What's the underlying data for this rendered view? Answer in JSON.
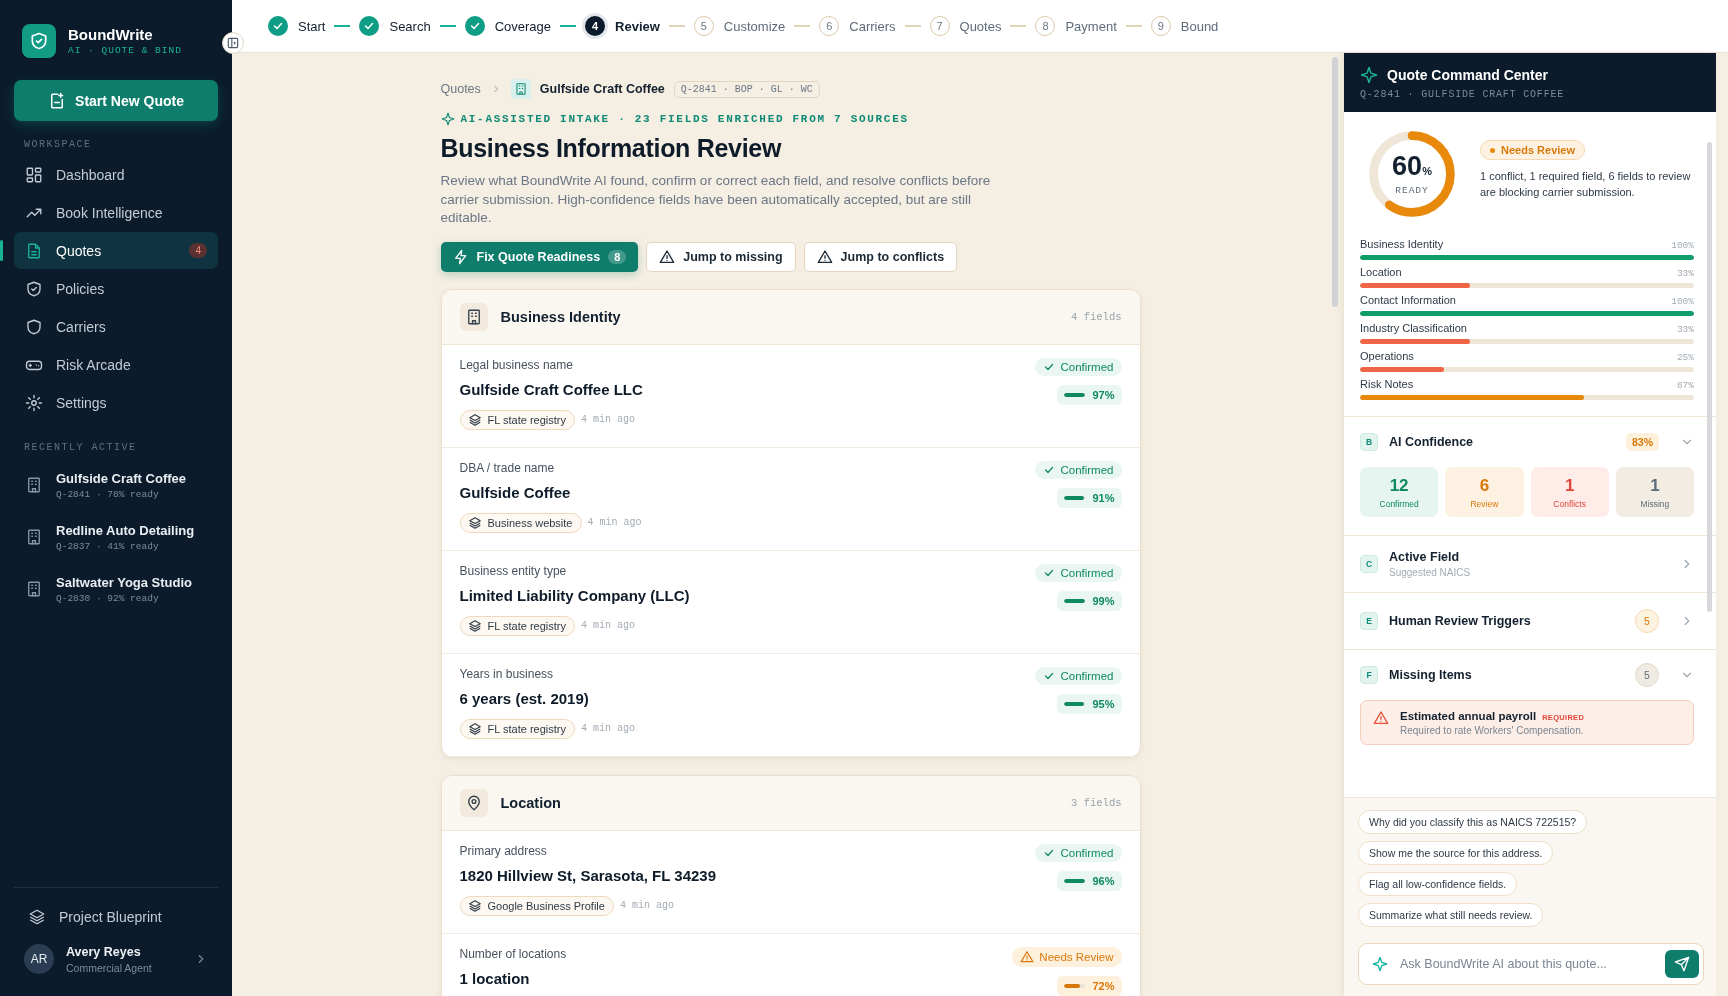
{
  "brand": {
    "name": "BoundWrite",
    "tagline": "AI · QUOTE & BIND"
  },
  "sidebar": {
    "new_quote_button": "Start New Quote",
    "workspace_label": "WORKSPACE",
    "nav": [
      {
        "label": "Dashboard",
        "kind": "grid",
        "selected": false
      },
      {
        "label": "Book Intelligence",
        "kind": "trend",
        "selected": false
      },
      {
        "label": "Quotes",
        "kind": "doc",
        "selected": true,
        "badge": "4"
      },
      {
        "label": "Policies",
        "kind": "policy",
        "selected": false
      },
      {
        "label": "Carriers",
        "kind": "shield",
        "selected": false
      },
      {
        "label": "Risk Arcade",
        "kind": "gamepad",
        "selected": false
      },
      {
        "label": "Settings",
        "kind": "gear",
        "selected": false
      }
    ],
    "recent_label": "RECENTLY ACTIVE",
    "recent": [
      {
        "name": "Gulfside Craft Coffee",
        "meta": "Q-2841 · 78% ready"
      },
      {
        "name": "Redline Auto Detailing",
        "meta": "Q-2837 · 41% ready"
      },
      {
        "name": "Saltwater Yoga Studio",
        "meta": "Q-2830 · 92% ready"
      }
    ],
    "blueprint": "Project Blueprint",
    "user": {
      "initials": "AR",
      "name": "Avery Reyes",
      "role": "Commercial Agent"
    }
  },
  "steps": [
    {
      "label": "Start",
      "kind": "done"
    },
    {
      "label": "Search",
      "kind": "done"
    },
    {
      "label": "Coverage",
      "kind": "done"
    },
    {
      "number": "4",
      "label": "Review",
      "kind": "current"
    },
    {
      "number": "5",
      "label": "Customize",
      "kind": "todo"
    },
    {
      "number": "6",
      "label": "Carriers",
      "kind": "todo"
    },
    {
      "number": "7",
      "label": "Quotes",
      "kind": "todo"
    },
    {
      "number": "8",
      "label": "Payment",
      "kind": "todo"
    },
    {
      "number": "9",
      "label": "Bound",
      "kind": "todo"
    }
  ],
  "breadcrumb": {
    "root": "Quotes",
    "current": "Gulfside Craft Coffee",
    "tags": "Q-2841 · BOP · GL · WC"
  },
  "eyebrow": "AI-ASSISTED INTAKE · 23 FIELDS ENRICHED FROM 7 SOURCES",
  "title": "Business Information Review",
  "description": "Review what BoundWrite AI found, confirm or correct each field, and resolve conflicts before carrier submission. High-confidence fields have been automatically accepted, but are still editable.",
  "actions": {
    "primary": {
      "label": "Fix Quote Readiness",
      "count": "8"
    },
    "secondary": [
      "Jump to missing",
      "Jump to conflicts"
    ]
  },
  "sections": [
    {
      "title": "Business Identity",
      "kind": "business",
      "count": "4 fields",
      "fields": [
        {
          "label": "Legal business name",
          "value": "Gulfside Craft Coffee LLC",
          "kind": "confirmed",
          "status_label": "Confirmed",
          "confidence": "97%",
          "level": 0.97,
          "source": "FL state registry",
          "time": "4 min ago"
        },
        {
          "label": "DBA / trade name",
          "value": "Gulfside Coffee",
          "kind": "confirmed",
          "status_label": "Confirmed",
          "confidence": "91%",
          "level": 0.91,
          "source": "Business website",
          "time": "4 min ago"
        },
        {
          "label": "Business entity type",
          "value": "Limited Liability Company (LLC)",
          "kind": "confirmed",
          "status_label": "Confirmed",
          "confidence": "99%",
          "level": 0.99,
          "source": "FL state registry",
          "time": "4 min ago"
        },
        {
          "label": "Years in business",
          "value": "6 years (est. 2019)",
          "kind": "confirmed",
          "status_label": "Confirmed",
          "confidence": "95%",
          "level": 0.95,
          "source": "FL state registry",
          "time": "4 min ago"
        }
      ]
    },
    {
      "title": "Location",
      "kind": "location",
      "count": "3 fields",
      "fields": [
        {
          "label": "Primary address",
          "value": "1820 Hillview St, Sarasota, FL 34239",
          "kind": "confirmed",
          "status_label": "Confirmed",
          "confidence": "96%",
          "level": 0.96,
          "source": "Google Business Profile",
          "time": "4 min ago"
        },
        {
          "label": "Number of locations",
          "value": "1 location",
          "kind": "review",
          "status_label": "Needs Review",
          "confidence": "72%",
          "level": 0.72
        }
      ]
    }
  ],
  "command_center": {
    "title": "Quote Command Center",
    "subtitle": "Q-2841 · GULFSIDE CRAFT COFFEE",
    "readiness": {
      "value": "60",
      "unit": "%",
      "label": "READY",
      "level": 0.6
    },
    "status": "Needs Review",
    "summary": "1 conflict, 1 required field, 6 fields to review are blocking carrier submission.",
    "bars": [
      {
        "label": "Business Identity",
        "reading": "100%",
        "level": 1.0,
        "color": "#0f9d6a"
      },
      {
        "label": "Location",
        "reading": "33%",
        "level": 0.33,
        "color": "#ef6548"
      },
      {
        "label": "Contact Information",
        "reading": "100%",
        "level": 1.0,
        "color": "#0f9d6a"
      },
      {
        "label": "Industry Classification",
        "reading": "33%",
        "level": 0.33,
        "color": "#ef6548"
      },
      {
        "label": "Operations",
        "reading": "25%",
        "level": 0.25,
        "color": "#ef6548"
      },
      {
        "label": "Risk Notes",
        "reading": "67%",
        "level": 0.67,
        "color": "#e8890c"
      }
    ],
    "ai_confidence": {
      "letter": "B",
      "title": "AI Confidence",
      "score": "83%",
      "expanded": true,
      "stats": [
        {
          "value": "12",
          "label": "Confirmed",
          "kind": "confirmed"
        },
        {
          "value": "6",
          "label": "Review",
          "kind": "review"
        },
        {
          "value": "1",
          "label": "Conflicts",
          "kind": "conflict"
        },
        {
          "value": "1",
          "label": "Missing",
          "kind": "missing"
        }
      ]
    },
    "active_field": {
      "letter": "C",
      "title": "Active Field",
      "subtitle": "Suggested NAICS",
      "expanded": false
    },
    "human_review": {
      "letter": "E",
      "title": "Human Review Triggers",
      "count": "5",
      "expanded": false
    },
    "missing_items": {
      "letter": "F",
      "title": "Missing Items",
      "count": "5",
      "expanded": true,
      "items": [
        {
          "title": "Estimated annual payroll",
          "tag": "REQUIRED",
          "description": "Required to rate Workers' Compensation."
        }
      ]
    },
    "suggestions": [
      "Why did you classify this as NAICS 722515?",
      "Show me the source for this address.",
      "Flag all low-confidence fields.",
      "Summarize what still needs review."
    ],
    "ask_placeholder": "Ask BoundWrite AI about this quote..."
  }
}
